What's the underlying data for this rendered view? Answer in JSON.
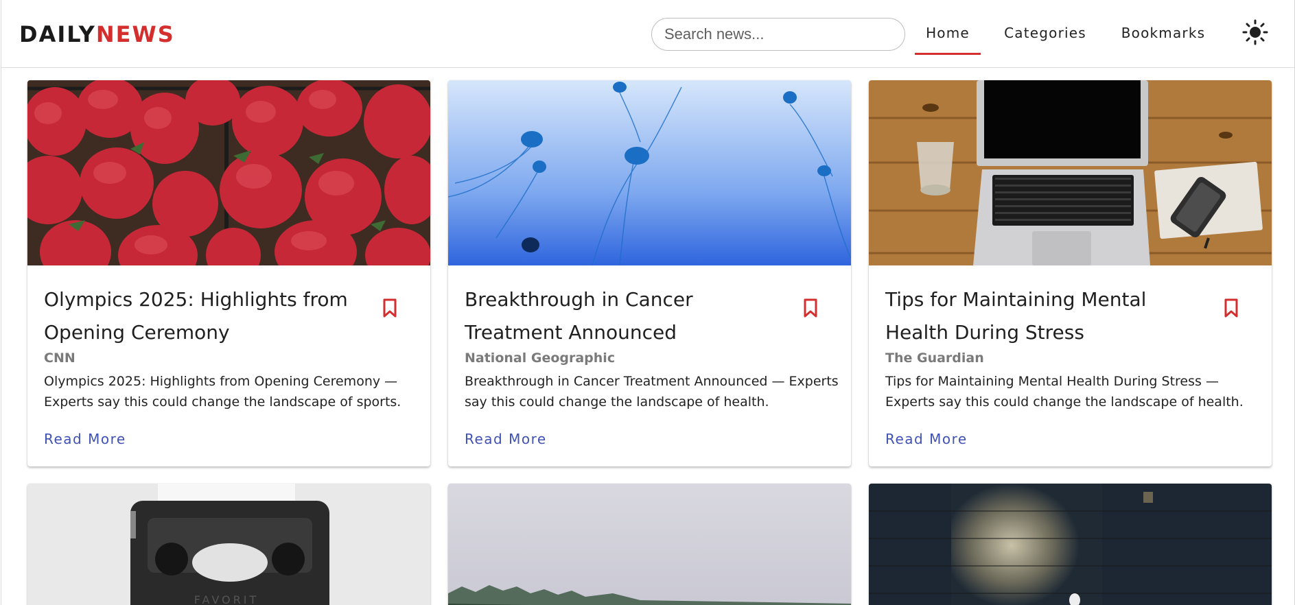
{
  "header": {
    "logo_part1": "DAILY",
    "logo_part2": "NEWS",
    "search_placeholder": "Search news...",
    "nav": [
      "Home",
      "Categories",
      "Bookmarks"
    ],
    "active_nav": "Home",
    "theme_icon": "sun-icon"
  },
  "colors": {
    "brand_red": "#d32f2f",
    "link_blue": "#3f51b5",
    "source_gray": "#7a7a7a"
  },
  "articles": [
    {
      "title": "Olympics 2025: Highlights from Opening Ceremony",
      "source": "CNN",
      "description": "Olympics 2025: Highlights from Opening Ceremony — Experts say this could change the landscape of sports.",
      "cta": "Read More",
      "image_subject": "strawberries"
    },
    {
      "title": "Breakthrough in Cancer Treatment Announced",
      "source": "National Geographic",
      "description": "Breakthrough in Cancer Treatment Announced — Experts say this could change the landscape of health.",
      "cta": "Read More",
      "image_subject": "jellyfish"
    },
    {
      "title": "Tips for Maintaining Mental Health During Stress",
      "source": "The Guardian",
      "description": "Tips for Maintaining Mental Health During Stress — Experts say this could change the landscape of health.",
      "cta": "Read More",
      "image_subject": "laptop-on-desk"
    },
    {
      "image_subject": "typewriter"
    },
    {
      "image_subject": "misty-forest"
    },
    {
      "image_subject": "brick-wall-light"
    }
  ]
}
